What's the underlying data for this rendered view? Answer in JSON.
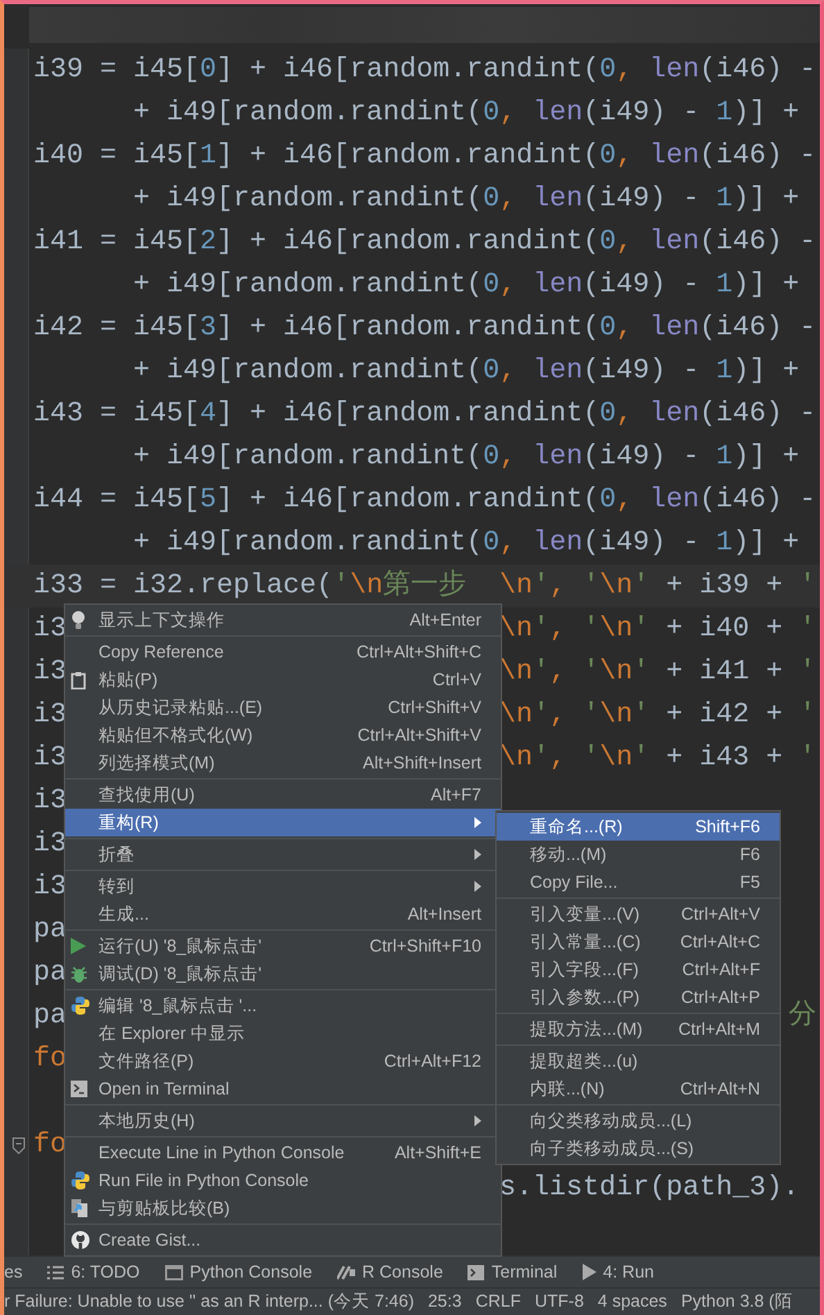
{
  "code_rows": [
    {
      "left": [
        {
          "kind": "plain",
          "text": "i39 = i45["
        },
        {
          "kind": "number",
          "text": "0"
        },
        {
          "kind": "plain",
          "text": "] + i46[random.randint("
        },
        {
          "kind": "number",
          "text": "0"
        },
        {
          "kind": "keyword",
          "text": ", "
        },
        {
          "kind": "builtin",
          "text": "len"
        },
        {
          "kind": "plain",
          "text": "(i46) -"
        }
      ]
    },
    {
      "left": [
        {
          "kind": "plain",
          "text": "      + i49[random.randint("
        },
        {
          "kind": "number",
          "text": "0"
        },
        {
          "kind": "keyword",
          "text": ", "
        },
        {
          "kind": "builtin",
          "text": "len"
        },
        {
          "kind": "plain",
          "text": "(i49) - "
        },
        {
          "kind": "number",
          "text": "1"
        },
        {
          "kind": "plain",
          "text": ")] +"
        }
      ]
    },
    {
      "left": [
        {
          "kind": "plain",
          "text": "i40 = i45["
        },
        {
          "kind": "number",
          "text": "1"
        },
        {
          "kind": "plain",
          "text": "] + i46[random.randint("
        },
        {
          "kind": "number",
          "text": "0"
        },
        {
          "kind": "keyword",
          "text": ", "
        },
        {
          "kind": "builtin",
          "text": "len"
        },
        {
          "kind": "plain",
          "text": "(i46) -"
        }
      ]
    },
    {
      "left": [
        {
          "kind": "plain",
          "text": "      + i49[random.randint("
        },
        {
          "kind": "number",
          "text": "0"
        },
        {
          "kind": "keyword",
          "text": ", "
        },
        {
          "kind": "builtin",
          "text": "len"
        },
        {
          "kind": "plain",
          "text": "(i49) - "
        },
        {
          "kind": "number",
          "text": "1"
        },
        {
          "kind": "plain",
          "text": ")] +"
        }
      ]
    },
    {
      "left": [
        {
          "kind": "plain",
          "text": "i41 = i45["
        },
        {
          "kind": "number",
          "text": "2"
        },
        {
          "kind": "plain",
          "text": "] + i46[random.randint("
        },
        {
          "kind": "number",
          "text": "0"
        },
        {
          "kind": "keyword",
          "text": ", "
        },
        {
          "kind": "builtin",
          "text": "len"
        },
        {
          "kind": "plain",
          "text": "(i46) -"
        }
      ]
    },
    {
      "left": [
        {
          "kind": "plain",
          "text": "      + i49[random.randint("
        },
        {
          "kind": "number",
          "text": "0"
        },
        {
          "kind": "keyword",
          "text": ", "
        },
        {
          "kind": "builtin",
          "text": "len"
        },
        {
          "kind": "plain",
          "text": "(i49) - "
        },
        {
          "kind": "number",
          "text": "1"
        },
        {
          "kind": "plain",
          "text": ")] +"
        }
      ]
    },
    {
      "left": [
        {
          "kind": "plain",
          "text": "i42 = i45["
        },
        {
          "kind": "number",
          "text": "3"
        },
        {
          "kind": "plain",
          "text": "] + i46[random.randint("
        },
        {
          "kind": "number",
          "text": "0"
        },
        {
          "kind": "keyword",
          "text": ", "
        },
        {
          "kind": "builtin",
          "text": "len"
        },
        {
          "kind": "plain",
          "text": "(i46) -"
        }
      ]
    },
    {
      "left": [
        {
          "kind": "plain",
          "text": "      + i49[random.randint("
        },
        {
          "kind": "number",
          "text": "0"
        },
        {
          "kind": "keyword",
          "text": ", "
        },
        {
          "kind": "builtin",
          "text": "len"
        },
        {
          "kind": "plain",
          "text": "(i49) - "
        },
        {
          "kind": "number",
          "text": "1"
        },
        {
          "kind": "plain",
          "text": ")] +"
        }
      ]
    },
    {
      "left": [
        {
          "kind": "plain",
          "text": "i43 = i45["
        },
        {
          "kind": "number",
          "text": "4"
        },
        {
          "kind": "plain",
          "text": "] + i46[random.randint("
        },
        {
          "kind": "number",
          "text": "0"
        },
        {
          "kind": "keyword",
          "text": ", "
        },
        {
          "kind": "builtin",
          "text": "len"
        },
        {
          "kind": "plain",
          "text": "(i46) -"
        }
      ]
    },
    {
      "left": [
        {
          "kind": "plain",
          "text": "      + i49[random.randint("
        },
        {
          "kind": "number",
          "text": "0"
        },
        {
          "kind": "keyword",
          "text": ", "
        },
        {
          "kind": "builtin",
          "text": "len"
        },
        {
          "kind": "plain",
          "text": "(i49) - "
        },
        {
          "kind": "number",
          "text": "1"
        },
        {
          "kind": "plain",
          "text": ")] +"
        }
      ]
    },
    {
      "left": [
        {
          "kind": "plain",
          "text": "i44 = i45["
        },
        {
          "kind": "number",
          "text": "5"
        },
        {
          "kind": "plain",
          "text": "] + i46[random.randint("
        },
        {
          "kind": "number",
          "text": "0"
        },
        {
          "kind": "keyword",
          "text": ", "
        },
        {
          "kind": "builtin",
          "text": "len"
        },
        {
          "kind": "plain",
          "text": "(i46) -"
        }
      ]
    },
    {
      "left": [
        {
          "kind": "plain",
          "text": "      + i49[random.randint("
        },
        {
          "kind": "number",
          "text": "0"
        },
        {
          "kind": "keyword",
          "text": ", "
        },
        {
          "kind": "builtin",
          "text": "len"
        },
        {
          "kind": "plain",
          "text": "(i49) - "
        },
        {
          "kind": "number",
          "text": "1"
        },
        {
          "kind": "plain",
          "text": ")] +"
        }
      ]
    },
    {
      "current": true,
      "left": [
        {
          "kind": "plain",
          "text": "i33 = i32.replace("
        },
        {
          "kind": "string",
          "text": "'"
        },
        {
          "kind": "escape",
          "text": "\\n"
        },
        {
          "kind": "string",
          "text": "第一步"
        }
      ],
      "right": [
        {
          "kind": "escape",
          "text": "\\n"
        },
        {
          "kind": "string",
          "text": "'"
        },
        {
          "kind": "keyword",
          "text": ", "
        },
        {
          "kind": "string",
          "text": "'"
        },
        {
          "kind": "escape",
          "text": "\\n"
        },
        {
          "kind": "string",
          "text": "'"
        },
        {
          "kind": "plain",
          "text": " + i39 + "
        },
        {
          "kind": "string",
          "text": "'"
        }
      ]
    },
    {
      "left": [
        {
          "kind": "plain",
          "text": "i3"
        }
      ],
      "right": [
        {
          "kind": "escape",
          "text": "\\n"
        },
        {
          "kind": "string",
          "text": "'"
        },
        {
          "kind": "keyword",
          "text": ", "
        },
        {
          "kind": "string",
          "text": "'"
        },
        {
          "kind": "escape",
          "text": "\\n"
        },
        {
          "kind": "string",
          "text": "'"
        },
        {
          "kind": "plain",
          "text": " + i40 + "
        },
        {
          "kind": "string",
          "text": "'"
        }
      ]
    },
    {
      "left": [
        {
          "kind": "plain",
          "text": "i3"
        }
      ],
      "right": [
        {
          "kind": "escape",
          "text": "\\n"
        },
        {
          "kind": "string",
          "text": "'"
        },
        {
          "kind": "keyword",
          "text": ", "
        },
        {
          "kind": "string",
          "text": "'"
        },
        {
          "kind": "escape",
          "text": "\\n"
        },
        {
          "kind": "string",
          "text": "'"
        },
        {
          "kind": "plain",
          "text": " + i41 + "
        },
        {
          "kind": "string",
          "text": "'"
        }
      ]
    },
    {
      "left": [
        {
          "kind": "plain",
          "text": "i3"
        }
      ],
      "right": [
        {
          "kind": "escape",
          "text": "\\n"
        },
        {
          "kind": "string",
          "text": "'"
        },
        {
          "kind": "keyword",
          "text": ", "
        },
        {
          "kind": "string",
          "text": "'"
        },
        {
          "kind": "escape",
          "text": "\\n"
        },
        {
          "kind": "string",
          "text": "'"
        },
        {
          "kind": "plain",
          "text": " + i42 + "
        },
        {
          "kind": "string",
          "text": "'"
        }
      ]
    },
    {
      "left": [
        {
          "kind": "plain",
          "text": "i3"
        }
      ],
      "right": [
        {
          "kind": "escape",
          "text": "\\n"
        },
        {
          "kind": "string",
          "text": "'"
        },
        {
          "kind": "keyword",
          "text": ", "
        },
        {
          "kind": "string",
          "text": "'"
        },
        {
          "kind": "escape",
          "text": "\\n"
        },
        {
          "kind": "string",
          "text": "'"
        },
        {
          "kind": "plain",
          "text": " + i43 + "
        },
        {
          "kind": "string",
          "text": "'"
        }
      ]
    },
    {
      "left": [
        {
          "kind": "plain",
          "text": "i3"
        }
      ]
    },
    {
      "left": [
        {
          "kind": "plain",
          "text": "i3"
        }
      ]
    },
    {
      "left": [
        {
          "kind": "plain",
          "text": "i3"
        }
      ]
    },
    {
      "left": [
        {
          "kind": "plain",
          "text": "pa"
        }
      ]
    },
    {
      "left": [
        {
          "kind": "plain",
          "text": "pa"
        }
      ]
    },
    {
      "left": [
        {
          "kind": "plain",
          "text": "pa"
        }
      ],
      "far": [
        {
          "kind": "string",
          "text": "分"
        }
      ]
    },
    {
      "left": [
        {
          "kind": "keyword",
          "text": "fo"
        }
      ]
    },
    {},
    {
      "fold": true,
      "left": [
        {
          "kind": "keyword",
          "text": "fo"
        }
      ]
    },
    {
      "right": [
        {
          "kind": "plain",
          "text": "s.listdir(path_3)."
        }
      ]
    }
  ],
  "context_menu": {
    "groups": [
      {
        "items": [
          {
            "label": "显示上下文操作",
            "shortcut": "Alt+Enter",
            "selected": false
          }
        ]
      },
      {
        "items": [
          {
            "label": "Copy Reference",
            "shortcut": "Ctrl+Alt+Shift+C",
            "selected": false
          },
          {
            "label": "粘贴(P)",
            "shortcut": "Ctrl+V",
            "selected": false
          },
          {
            "label": "从历史记录粘贴...(E)",
            "shortcut": "Ctrl+Shift+V",
            "selected": false
          },
          {
            "label": "粘贴但不格式化(W)",
            "shortcut": "Ctrl+Alt+Shift+V",
            "selected": false
          },
          {
            "label": "列选择模式(M)",
            "shortcut": "Alt+Shift+Insert",
            "selected": false
          }
        ]
      },
      {
        "items": [
          {
            "label": "查找使用(U)",
            "shortcut": "Alt+F7",
            "selected": false
          },
          {
            "label": "重构(R)",
            "submenu": true,
            "selected": true
          }
        ]
      },
      {
        "items": [
          {
            "label": "折叠",
            "submenu": true,
            "selected": false
          }
        ]
      },
      {
        "items": [
          {
            "label": "转到",
            "submenu": true,
            "selected": false
          },
          {
            "label": "生成...",
            "shortcut": "Alt+Insert",
            "selected": false
          }
        ]
      },
      {
        "items": [
          {
            "label": "运行(U) '8_鼠标点击'",
            "shortcut": "Ctrl+Shift+F10",
            "selected": false
          },
          {
            "label": "调试(D) '8_鼠标点击'",
            "selected": false
          }
        ]
      },
      {
        "items": [
          {
            "label": "编辑 '8_鼠标点击 '...",
            "selected": false
          },
          {
            "label": "在 Explorer 中显示",
            "selected": false
          },
          {
            "label": "文件路径(P)",
            "shortcut": "Ctrl+Alt+F12",
            "selected": false
          },
          {
            "label": "Open in Terminal",
            "selected": false
          }
        ]
      },
      {
        "items": [
          {
            "label": "本地历史(H)",
            "submenu": true,
            "selected": false
          }
        ]
      },
      {
        "items": [
          {
            "label": "Execute Line in Python Console",
            "shortcut": "Alt+Shift+E",
            "selected": false
          },
          {
            "label": "Run File in Python Console",
            "selected": false
          },
          {
            "label": "与剪贴板比较(B)",
            "selected": false
          }
        ]
      },
      {
        "items": [
          {
            "label": "Create Gist...",
            "selected": false
          }
        ]
      }
    ]
  },
  "refactor_submenu": {
    "groups": [
      {
        "items": [
          {
            "label": "重命名...(R)",
            "shortcut": "Shift+F6",
            "selected": true
          },
          {
            "label": "移动...(M)",
            "shortcut": "F6",
            "selected": false
          },
          {
            "label": "Copy File...",
            "shortcut": "F5",
            "selected": false
          }
        ]
      },
      {
        "items": [
          {
            "label": "引入变量...(V)",
            "shortcut": "Ctrl+Alt+V",
            "selected": false
          },
          {
            "label": "引入常量...(C)",
            "shortcut": "Ctrl+Alt+C",
            "selected": false
          },
          {
            "label": "引入字段...(F)",
            "shortcut": "Ctrl+Alt+F",
            "selected": false
          },
          {
            "label": "引入参数...(P)",
            "shortcut": "Ctrl+Alt+P",
            "selected": false
          }
        ]
      },
      {
        "items": [
          {
            "label": "提取方法...(M)",
            "shortcut": "Ctrl+Alt+M",
            "selected": false
          }
        ]
      },
      {
        "items": [
          {
            "label": "提取超类...(u)",
            "selected": false
          },
          {
            "label": "内联...(N)",
            "shortcut": "Ctrl+Alt+N",
            "selected": false
          }
        ]
      },
      {
        "items": [
          {
            "label": "向父类移动成员...(L)",
            "selected": false
          },
          {
            "label": "向子类移动成员...(S)",
            "selected": false
          }
        ]
      }
    ]
  },
  "tool_tabs": [
    {
      "label": "es"
    },
    {
      "label": "6: TODO"
    },
    {
      "label": "Python Console"
    },
    {
      "label": "R Console"
    },
    {
      "label": "Terminal"
    },
    {
      "label": "4: Run"
    }
  ],
  "status_bar": [
    "r Failure: Unable to use '' as an R interp... (今天 7:46)",
    "25:3",
    "CRLF",
    "UTF-8",
    "4 spaces",
    "Python 3.8 (陌"
  ]
}
